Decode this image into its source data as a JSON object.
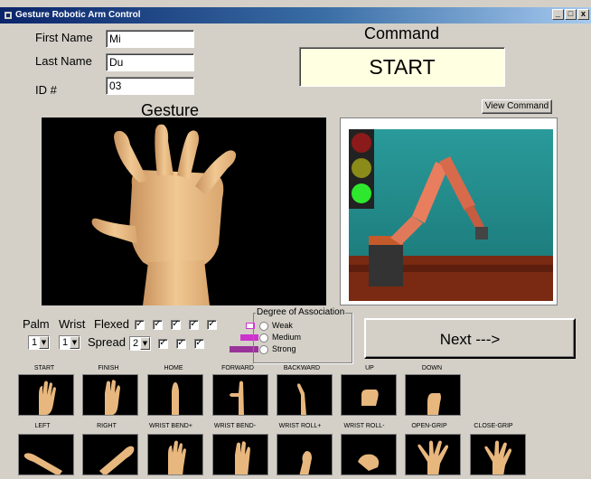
{
  "window": {
    "title": "Gesture Robotic Arm Control",
    "controls": [
      "_",
      "□",
      "x"
    ]
  },
  "form": {
    "first_name_label": "First Name",
    "first_name_value": "Mi",
    "last_name_label": "Last Name",
    "last_name_value": "Du",
    "id_label": "ID #",
    "id_value": "03"
  },
  "command": {
    "heading": "Command",
    "value": "START",
    "view_button": "View Command"
  },
  "gesture": {
    "heading": "Gesture"
  },
  "controls": {
    "palm_label": "Palm",
    "wrist_label": "Wrist",
    "flexed_label": "Flexed",
    "spread_label": "Spread",
    "palm_value": "1",
    "wrist_value": "1",
    "spread_value": "2",
    "flexed_checks": [
      true,
      true,
      true,
      true,
      true
    ],
    "spread_checks": [
      true,
      true,
      true
    ]
  },
  "association": {
    "legend": "Degree of Association",
    "options": [
      "Weak",
      "Medium",
      "Strong"
    ]
  },
  "next_button": "Next --->",
  "gesture_row1": [
    "START",
    "FINISH",
    "HOME",
    "FORWARD",
    "BACKWARD",
    "UP",
    "DOWN"
  ],
  "gesture_row2": [
    "LEFT",
    "RIGHT",
    "WRIST BEND+",
    "WRIST BEND-",
    "WRIST ROLL+",
    "WRIST ROLL-",
    "OPEN-GRIP",
    "CLOSE-GRIP"
  ],
  "colors": {
    "traffic_red": "#8b1a1a",
    "traffic_yellow": "#8b8b1a",
    "traffic_green": "#2ee82e",
    "bar_color": "#cc33cc"
  }
}
